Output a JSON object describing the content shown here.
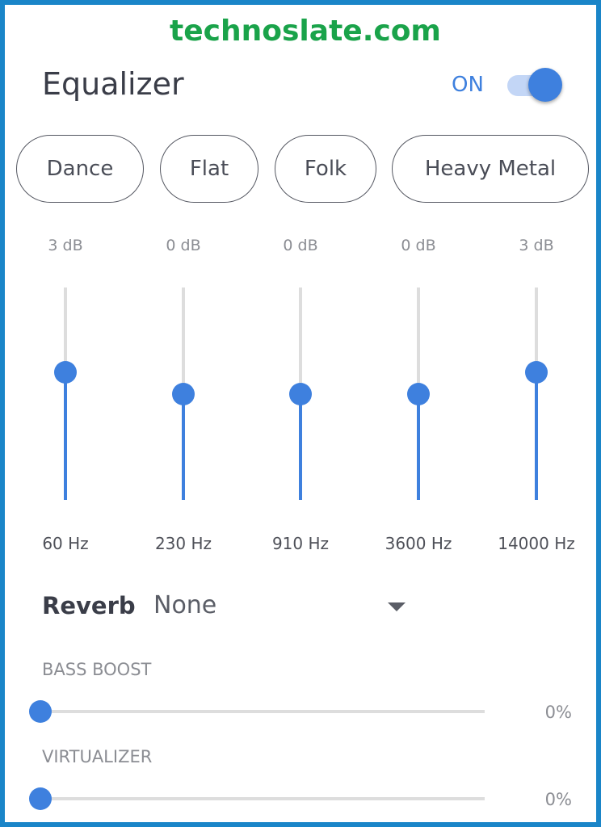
{
  "watermark": "technoslate.com",
  "header": {
    "title": "Equalizer",
    "toggle_label": "ON",
    "toggle_on": true
  },
  "presets": [
    {
      "label": "Dance"
    },
    {
      "label": "Flat"
    },
    {
      "label": "Folk"
    },
    {
      "label": "Heavy Metal"
    }
  ],
  "bands": [
    {
      "freq": "60 Hz",
      "gain": "3 dB",
      "gain_db": 3
    },
    {
      "freq": "230 Hz",
      "gain": "0 dB",
      "gain_db": 0
    },
    {
      "freq": "910 Hz",
      "gain": "0 dB",
      "gain_db": 0
    },
    {
      "freq": "3600 Hz",
      "gain": "0 dB",
      "gain_db": 0
    },
    {
      "freq": "14000 Hz",
      "gain": "3 dB",
      "gain_db": 3
    }
  ],
  "band_range_db": [
    -15,
    15
  ],
  "reverb": {
    "label": "Reverb",
    "value": "None"
  },
  "bass_boost": {
    "label": "BASS BOOST",
    "value_text": "0%",
    "value": 0
  },
  "virtualizer": {
    "label": "VIRTUALIZER",
    "value_text": "0%",
    "value": 0
  },
  "colors": {
    "accent": "#3e80de",
    "watermark": "#1aa34a",
    "frame": "#1a85c8"
  }
}
